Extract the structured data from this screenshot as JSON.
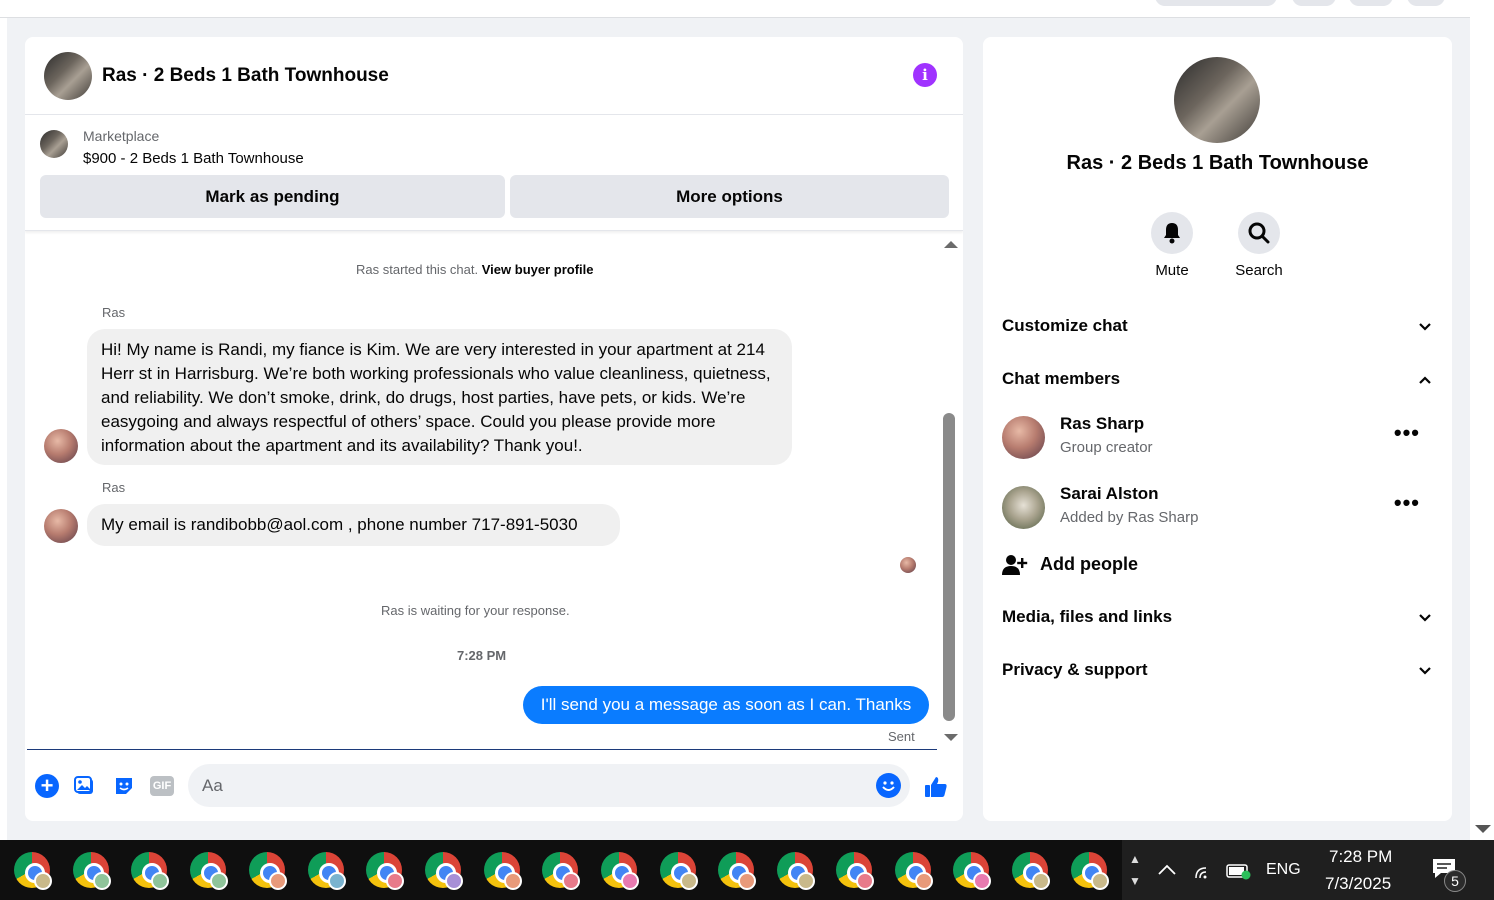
{
  "chat": {
    "title": "Ras · 2 Beds 1 Bath Townhouse",
    "listing": {
      "source": "Marketplace",
      "price_title": "$900 - 2 Beds 1 Bath Townhouse",
      "mark_pending": "Mark as pending",
      "more_options": "More options"
    },
    "started_text": "Ras started this chat.",
    "view_profile": "View buyer profile",
    "messages": [
      {
        "sender": "Ras",
        "text": "Hi! My name is Randi, my fiance is Kim. We are very interested in your apartment at 214 Herr st in Harrisburg. We’re both working professionals who value cleanliness, quietness, and reliability. We don’t smoke, drink, do drugs, host parties, have pets, or kids. We’re easygoing and always respectful of others’ space. Could you please provide more information about the apartment and its availability? Thank you!."
      },
      {
        "sender": "Ras",
        "text": "My email is randibobb@aol.com , phone number 717-891-5030"
      }
    ],
    "waiting_text": "Ras is waiting for your response.",
    "timestamp": "7:28 PM",
    "outgoing": "I'll send you a message as soon as I can. Thanks",
    "sent_status": "Sent",
    "composer": {
      "placeholder": "Aa",
      "gif_label": "GIF"
    }
  },
  "details": {
    "title": "Ras · 2 Beds 1 Bath Townhouse",
    "actions": [
      {
        "label": "Mute",
        "icon": "bell-icon"
      },
      {
        "label": "Search",
        "icon": "search-icon"
      }
    ],
    "sections": {
      "customize": "Customize chat",
      "members": "Chat members",
      "media": "Media, files and links",
      "privacy": "Privacy & support"
    },
    "members": [
      {
        "name": "Ras Sharp",
        "role": "Group creator",
        "more": "•••"
      },
      {
        "name": "Sarai Alston",
        "role": "Added by Ras Sharp",
        "more": "•••"
      }
    ],
    "add_people": "Add people"
  },
  "taskbar": {
    "language": "ENG",
    "time": "7:28 PM",
    "date": "7/3/2025",
    "notification_count": "5",
    "profile_colors": [
      "#c9b98a",
      "#8fc49a",
      "#8fc49a",
      "#8fc49a",
      "#e89a7a",
      "#7ab3cf",
      "#e87a8a",
      "#a78fd6",
      "#e89a7a",
      "#e87a8a",
      "#e87ab0",
      "#c9b98a",
      "#e89a7a",
      "#c9b98a",
      "#e87a8a",
      "#e89a7a",
      "#e87ab0",
      "#c9b98a",
      "#c9b98a"
    ]
  },
  "colors": {
    "accent_blue": "#0866ff",
    "bubble_out": "#0a7cff",
    "info_purple": "#a033ff"
  }
}
